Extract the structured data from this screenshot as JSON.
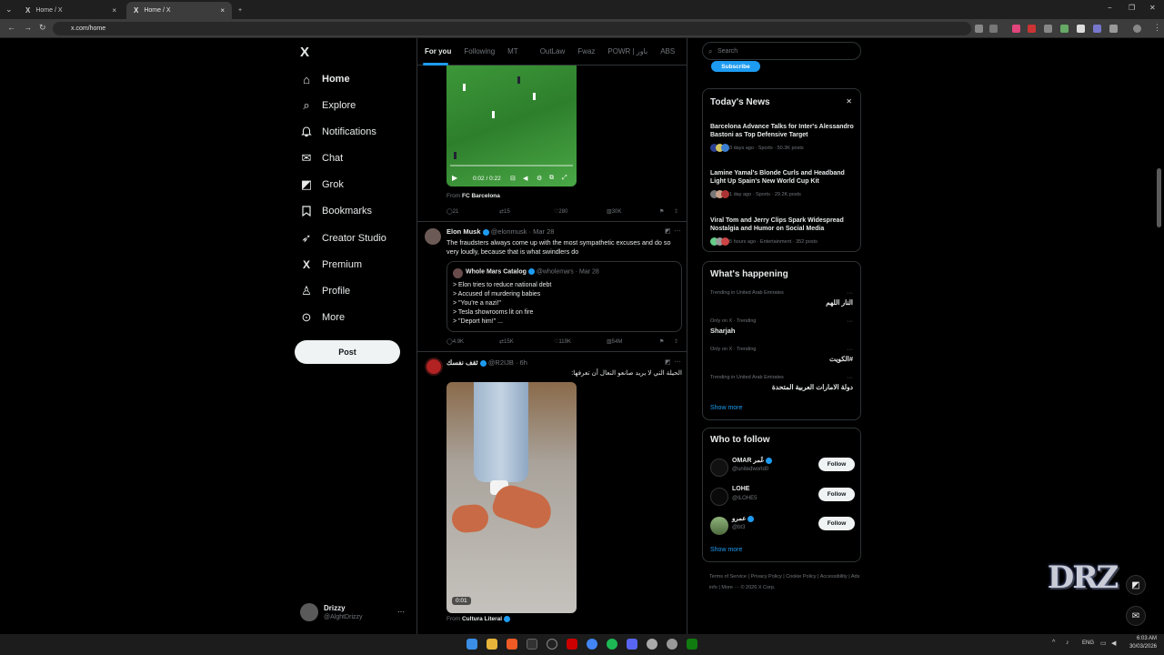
{
  "browser": {
    "tabs": [
      {
        "title": "Home / X",
        "close": "×"
      },
      {
        "title": "Home / X",
        "close": "×"
      }
    ],
    "new_tab": "+",
    "url": "x.com/home",
    "win_min": "−",
    "win_max": "❐",
    "win_close": "✕"
  },
  "nav": {
    "logo": "X",
    "items": [
      {
        "label": "Home",
        "icon": "home-icon",
        "glyph": "⌂"
      },
      {
        "label": "Explore",
        "icon": "search-icon",
        "glyph": "⌕"
      },
      {
        "label": "Notifications",
        "icon": "bell-icon",
        "glyph": "♫"
      },
      {
        "label": "Chat",
        "icon": "mail-icon",
        "glyph": "✉"
      },
      {
        "label": "Grok",
        "icon": "grok-icon",
        "glyph": "◩"
      },
      {
        "label": "Bookmarks",
        "icon": "bookmark-icon",
        "glyph": "⚑"
      },
      {
        "label": "Creator Studio",
        "icon": "rocket-icon",
        "glyph": "➶"
      },
      {
        "label": "Premium",
        "icon": "x-premium-icon",
        "glyph": "X"
      },
      {
        "label": "Profile",
        "icon": "person-icon",
        "glyph": "♙"
      },
      {
        "label": "More",
        "icon": "more-circle-icon",
        "glyph": "⊙"
      }
    ],
    "post_label": "Post",
    "account": {
      "name": "Drizzy",
      "handle": "@AlghtDrizzy",
      "more": "···"
    }
  },
  "feed": {
    "tabs": [
      "For you",
      "Following",
      "MT",
      "OutLaw",
      "Fwaz",
      "POWR | باور",
      "ABS"
    ],
    "post1": {
      "video_time": "0:02 / 0:22",
      "from_prefix": "From",
      "from_name": "FC Barcelona",
      "replies": "21",
      "reposts": "15",
      "likes": "280",
      "views": "30K"
    },
    "post2": {
      "name": "Elon Musk",
      "handle": "@elonmusk",
      "date": "Mar 28",
      "text": "The fraudsters always come up with the most sympathetic excuses and do so very loudly, because that is what swindlers do",
      "quote": {
        "name": "Whole Mars Catalog",
        "handle": "@wholemars",
        "date": "Mar 28",
        "lines": [
          "> Elon tries to reduce national debt",
          "> Accused of murdering babies",
          "> \"You're a nazi!\"",
          "> Tesla showrooms lit on fire",
          "> \"Deport him!\" ..."
        ]
      },
      "replies": "4.9K",
      "reposts": "15K",
      "likes": "119K",
      "views": "54M"
    },
    "post3": {
      "name": "ثقف نفسك",
      "handle": "@R2IJB",
      "time": "6h",
      "text": "الحيلة التي لا يريد صانعو النعال أن تعرفها:",
      "video_time": "0:01",
      "from_prefix": "From",
      "from_name": "Cultura Literal"
    }
  },
  "right": {
    "search_placeholder": "Search",
    "subscribe": "Subscribe",
    "news": {
      "title": "Today's News",
      "close": "✕",
      "items": [
        {
          "headline": "Barcelona Advance Talks for Inter's Alessandro Bastoni as Top Defensive Target",
          "meta": "3 days ago · Sports · 50.3K posts"
        },
        {
          "headline": "Lamine Yamal's Blonde Curls and Headband Light Up Spain's New World Cup Kit",
          "meta": "1 day ago · Sports · 29.2K posts"
        },
        {
          "headline": "Viral Tom and Jerry Clips Spark Widespread Nostalgia and Humor on Social Media",
          "meta": "5 hours ago · Entertainment · 352 posts"
        }
      ]
    },
    "happening": {
      "title": "What's happening",
      "items": [
        {
          "meta": "Trending in United Arab Emirates",
          "name": "النار اللهم",
          "rtl": true
        },
        {
          "meta": "Only on X · Trending",
          "name": "Sharjah",
          "rtl": false
        },
        {
          "meta": "Only on X · Trending",
          "name": "#الكويت",
          "rtl": true
        },
        {
          "meta": "Trending in United Arab Emirates",
          "name": "دولة الامارات العربية المتحدة",
          "rtl": true
        }
      ],
      "show_more": "Show more"
    },
    "follow": {
      "title": "Who to follow",
      "items": [
        {
          "name": "OMAR عُمر",
          "handle": "@unitedworld0",
          "button": "Follow"
        },
        {
          "name": "LOHE",
          "handle": "@ILOHE5",
          "button": "Follow"
        },
        {
          "name": "عمرو",
          "handle": "@bt3",
          "button": "Follow"
        }
      ],
      "show_more": "Show more"
    },
    "footer": [
      "Terms of Service",
      "Privacy Policy",
      "Cookie Policy",
      "Accessibility",
      "Ads info",
      "More ···",
      "© 2026 X Corp."
    ]
  },
  "overlay": {
    "logo_text": "DRZ"
  },
  "taskbar": {
    "lang": "ENG",
    "time": "6:03 AM",
    "date": "30/03/2026"
  }
}
